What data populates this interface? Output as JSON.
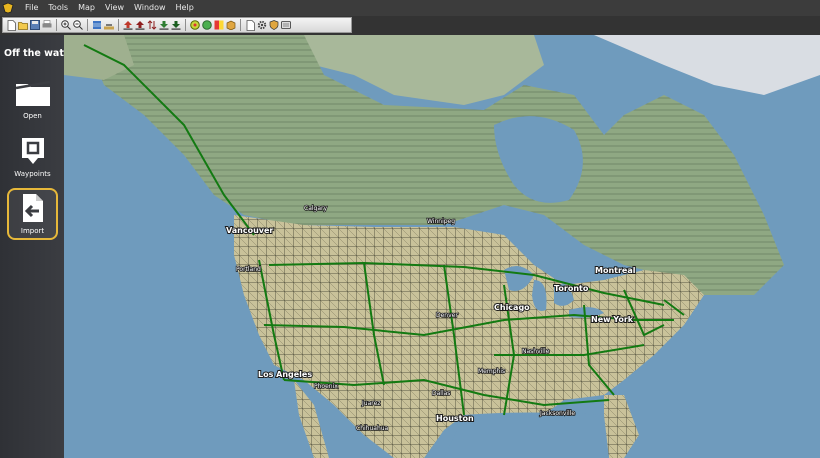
{
  "menu": [
    "File",
    "Tools",
    "Map",
    "View",
    "Window",
    "Help"
  ],
  "sidebar": {
    "title": "Off the water",
    "buttons": [
      {
        "label": "Open",
        "icon": "folder-icon"
      },
      {
        "label": "Waypoints",
        "icon": "waypoint-icon"
      },
      {
        "label": "Import",
        "icon": "import-icon",
        "active": true
      }
    ]
  },
  "map": {
    "cities": [
      "Vancouver",
      "Calgary",
      "Winnipeg",
      "Portland",
      "Montreal",
      "Toronto",
      "Chicago",
      "New York",
      "Denver",
      "Los Angeles",
      "Phoenix",
      "Dallas",
      "Houston",
      "Juarez",
      "Chihuahua",
      "Memphis",
      "Nashville",
      "Jacksonville"
    ]
  },
  "colors": {
    "accent": "#e6b83a",
    "route": "#137a12",
    "water": "#6f9bbd",
    "land": "#b9b48d"
  }
}
